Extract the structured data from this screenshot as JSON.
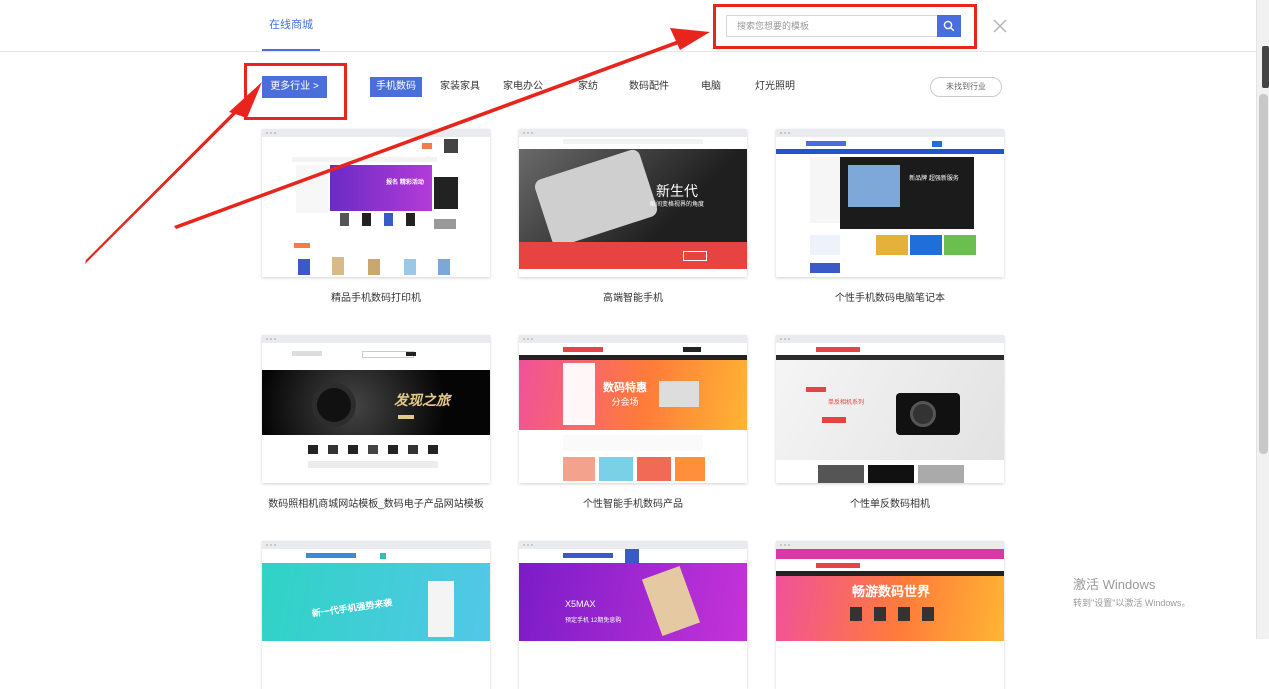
{
  "header": {
    "tab_label": "在线商城",
    "search_placeholder": "搜索您想要的模板"
  },
  "categories": {
    "more_label": "更多行业 >",
    "items": [
      "手机数码",
      "家装家具",
      "家电办公",
      "家纺",
      "数码配件",
      "电脑",
      "灯光照明"
    ],
    "not_found_label": "未找到行业"
  },
  "templates": [
    {
      "title": "精品手机数码打印机",
      "banner_text": "报名 精彩活动"
    },
    {
      "title": "高端智能手机",
      "banner_text": "新生代",
      "banner_sub": "瞬间变格视界的角度"
    },
    {
      "title": "个性手机数码电脑笔记本",
      "banner_text": "新品牌 超强新服务"
    },
    {
      "title": "数码照相机商城网站模板_数码电子产品网站模板",
      "banner_text": "发现之旅"
    },
    {
      "title": "个性智能手机数码产品",
      "banner_text": "数码特惠",
      "banner_sub": "分会场"
    },
    {
      "title": "个性单反数码相机",
      "banner_text": "单反相机系列"
    },
    {
      "title": "",
      "banner_text": "新一代手机强势来袭"
    },
    {
      "title": "",
      "banner_text": "X5MAX",
      "banner_sub": "预定手机 12期免息购"
    },
    {
      "title": "",
      "banner_text": "畅游数码世界"
    }
  ],
  "watermark": {
    "line1": "激活 Windows",
    "line2": "转到\"设置\"以激活 Windows。"
  },
  "icons": {
    "search": "search-icon",
    "close": "close-icon"
  },
  "colors": {
    "accent": "#4a6fdc",
    "annotation_red": "#e8251d"
  }
}
